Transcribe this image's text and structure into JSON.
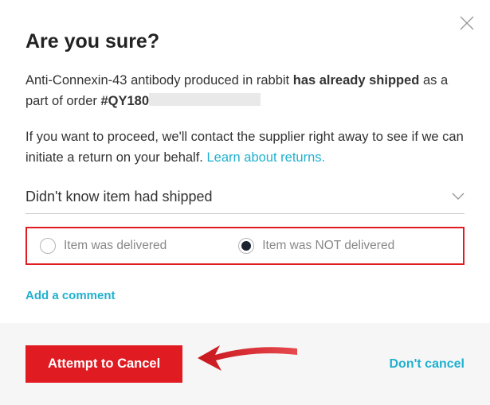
{
  "title": "Are you sure?",
  "shipNotice": {
    "product": "Anti-Connexin-43 antibody produced in rabbit",
    "statusBold": "has already shipped",
    "suffix1": " as a part of order ",
    "orderBold": "#QY180"
  },
  "proceedNotice": {
    "text": "If you want to proceed, we'll contact the supplier right away to see if we can initiate a return on your behalf. ",
    "link": "Learn about returns."
  },
  "reasonSelect": "Didn't know item had shipped",
  "delivery": {
    "delivered": "Item was delivered",
    "notDelivered": "Item was NOT delivered",
    "selected": "notDelivered"
  },
  "addComment": "Add a comment",
  "buttons": {
    "primary": "Attempt to Cancel",
    "secondary": "Don't cancel"
  }
}
